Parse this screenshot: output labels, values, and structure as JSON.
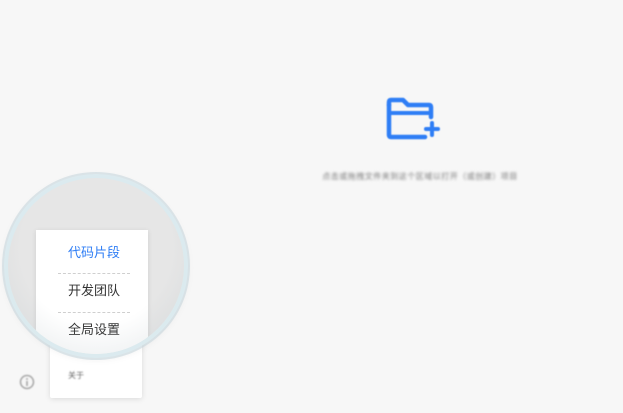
{
  "empty_state": {
    "icon": "folder-plus-icon",
    "hint": "点击或拖拽文件夹到这个区域以打开（或创建）项目",
    "accent": "#2f7ef5"
  },
  "menu": {
    "items": [
      {
        "label": "代码片段",
        "active": true
      },
      {
        "label": "开发团队",
        "active": false
      },
      {
        "label": "全局设置",
        "active": false
      }
    ],
    "about_label": "关于",
    "active_color": "#2f7ef5"
  },
  "footer": {
    "info_icon": "info-icon"
  }
}
